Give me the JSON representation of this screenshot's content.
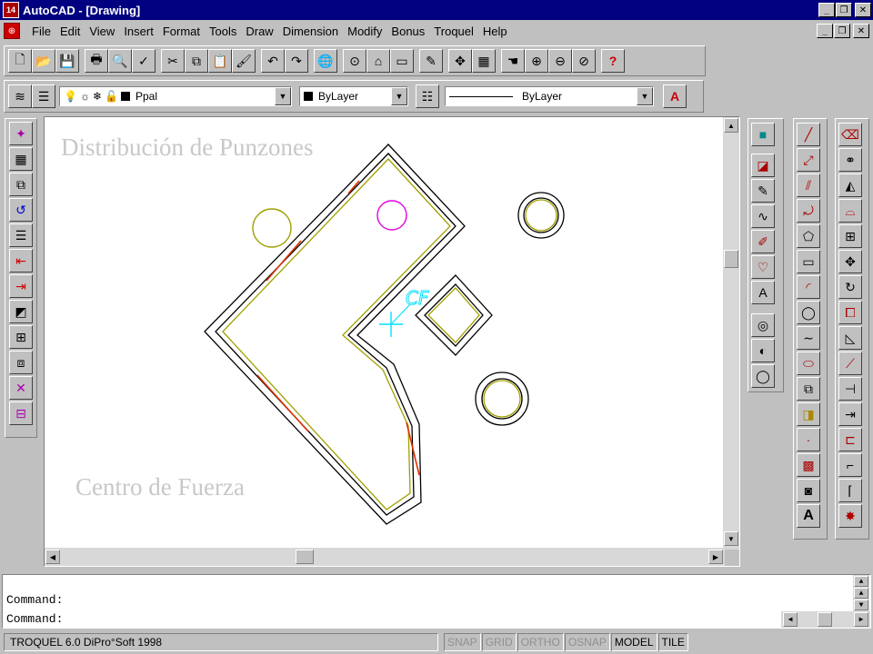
{
  "window": {
    "app_title": "AutoCAD - [Drawing]",
    "app_icon_label": "14",
    "minimize": "_",
    "maximize": "❐",
    "close": "✕"
  },
  "menu": {
    "items": [
      "File",
      "Edit",
      "View",
      "Insert",
      "Format",
      "Tools",
      "Draw",
      "Dimension",
      "Modify",
      "Bonus",
      "Troquel",
      "Help"
    ],
    "doc_minimize": "_",
    "doc_restore": "❐",
    "doc_close": "✕"
  },
  "object_toolbar": {
    "layer": "Ppal",
    "color": "ByLayer",
    "linetype": "ByLayer"
  },
  "canvas": {
    "top_label": "Distribución de Punzones",
    "bottom_label": "Centro de Fuerza",
    "marker_label": "CF"
  },
  "command": {
    "line1": "Command:",
    "line2": "Command:"
  },
  "statusbar": {
    "text": "TROQUEL 6.0 DiPro°Soft 1998",
    "toggles": [
      {
        "label": "SNAP",
        "on": false
      },
      {
        "label": "GRID",
        "on": false
      },
      {
        "label": "ORTHO",
        "on": false
      },
      {
        "label": "OSNAP",
        "on": false
      },
      {
        "label": "MODEL",
        "on": true
      },
      {
        "label": "TILE",
        "on": true
      }
    ]
  },
  "colors": {
    "titlebar": "#000080",
    "face": "#c0c0c0",
    "canvas": "#ffffff",
    "punch_outline": "#000000",
    "offset_yellow": "#a0a000",
    "edge_red": "#e03000",
    "magenta_circle": "#e000e0",
    "marker_cyan": "#00e0ff"
  }
}
